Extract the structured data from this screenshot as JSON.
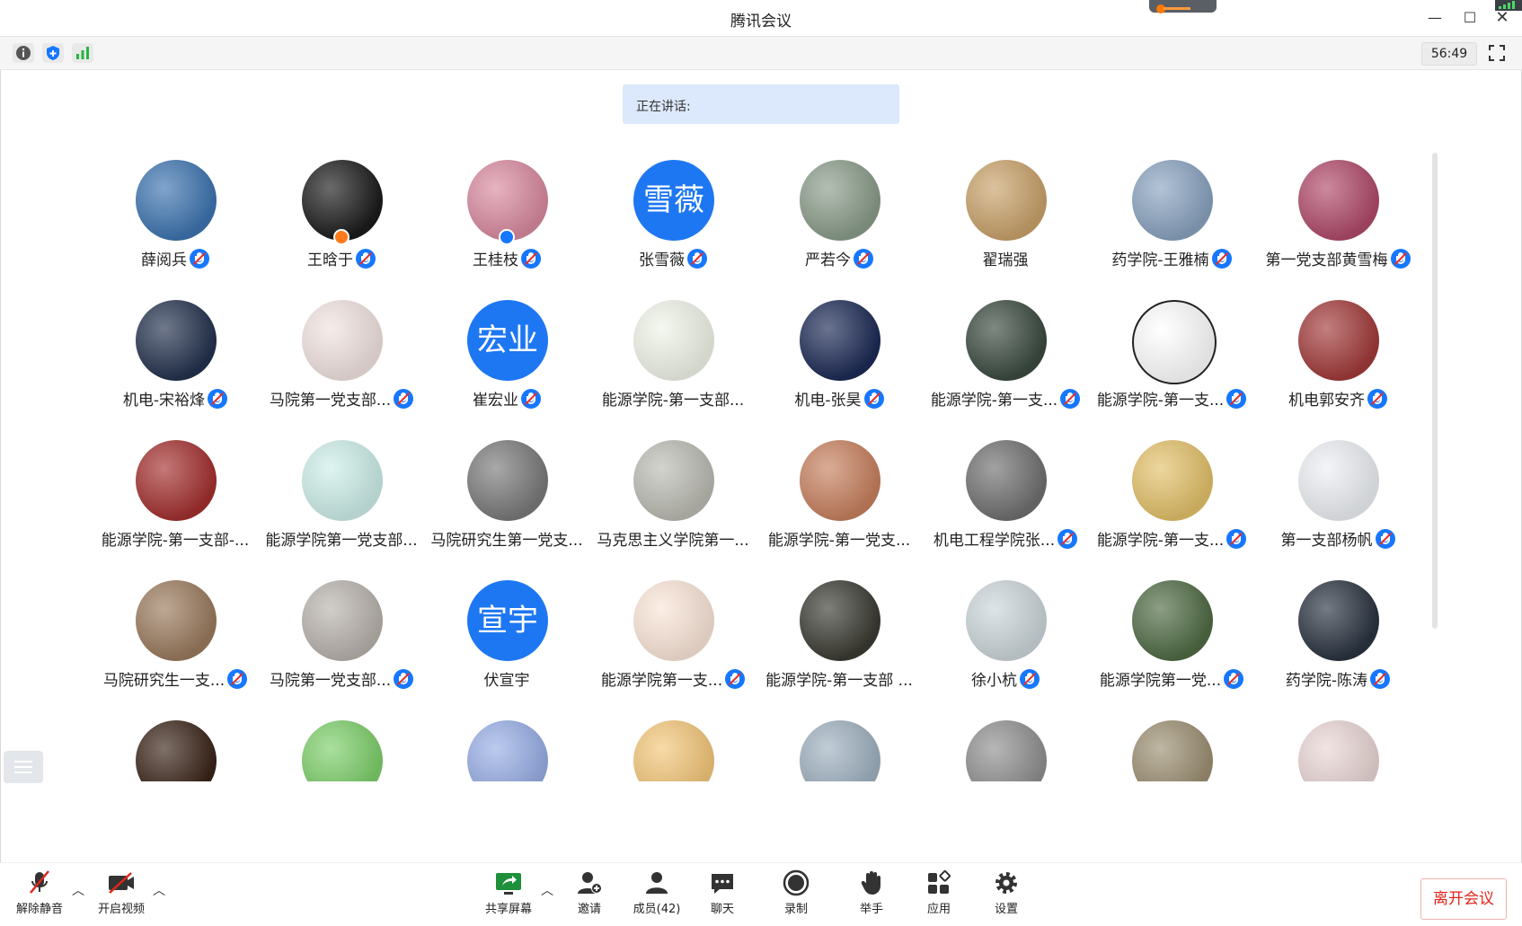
{
  "window": {
    "title": "腾讯会议"
  },
  "toolbar": {
    "timer": "56:49"
  },
  "speaking": {
    "label": "正在讲话:"
  },
  "participants": [
    {
      "name": "薛阅兵",
      "mic": true
    },
    {
      "name": "王晗于",
      "mic": true
    },
    {
      "name": "王桂枝",
      "mic": true
    },
    {
      "name": "张雪薇",
      "mic": true,
      "avatar_text": "雪薇"
    },
    {
      "name": "严若今",
      "mic": true
    },
    {
      "name": "翟瑞强",
      "mic": false
    },
    {
      "name": "药学院-王雅楠",
      "mic": true
    },
    {
      "name": "第一党支部黄雪梅",
      "mic": true
    },
    {
      "name": "机电-宋裕烽",
      "mic": true
    },
    {
      "name": "马院第一党支部...",
      "mic": true
    },
    {
      "name": "崔宏业",
      "mic": true,
      "avatar_text": "宏业"
    },
    {
      "name": "能源学院-第一支部...",
      "mic": false
    },
    {
      "name": "机电-张昊",
      "mic": true
    },
    {
      "name": "能源学院-第一支...",
      "mic": true
    },
    {
      "name": "能源学院-第一支...",
      "mic": true
    },
    {
      "name": "机电郭安齐",
      "mic": true
    },
    {
      "name": "能源学院-第一支部-...",
      "mic": false
    },
    {
      "name": "能源学院第一党支部...",
      "mic": false
    },
    {
      "name": "马院研究生第一党支...",
      "mic": false
    },
    {
      "name": "马克思主义学院第一...",
      "mic": false
    },
    {
      "name": "能源学院-第一党支...",
      "mic": false
    },
    {
      "name": "机电工程学院张...",
      "mic": true
    },
    {
      "name": "能源学院-第一支...",
      "mic": true
    },
    {
      "name": "第一支部杨帆",
      "mic": true
    },
    {
      "name": "马院研究生一支...",
      "mic": true
    },
    {
      "name": "马院第一党支部...",
      "mic": true
    },
    {
      "name": "伏宣宇",
      "mic": false,
      "avatar_text": "宣宇"
    },
    {
      "name": "能源学院第一支...",
      "mic": true
    },
    {
      "name": "能源学院-第一支部 ...",
      "mic": false
    },
    {
      "name": "徐小杭",
      "mic": true
    },
    {
      "name": "能源学院第一党...",
      "mic": true
    },
    {
      "name": "药学院-陈涛",
      "mic": true
    },
    {
      "name": "",
      "mic": false
    },
    {
      "name": "",
      "mic": false
    },
    {
      "name": "",
      "mic": false
    },
    {
      "name": "",
      "mic": false
    },
    {
      "name": "",
      "mic": false
    },
    {
      "name": "",
      "mic": false
    },
    {
      "name": "",
      "mic": false
    },
    {
      "name": "",
      "mic": false
    }
  ],
  "bottom": {
    "unmute": "解除静音",
    "start_video": "开启视频",
    "share": "共享屏幕",
    "invite": "邀请",
    "members": "成员(42)",
    "chat": "聊天",
    "record": "录制",
    "raise_hand": "举手",
    "apps": "应用",
    "settings": "设置",
    "leave": "离开会议"
  },
  "colors": {
    "accent": "#1677ff",
    "leave_red": "#e1251b",
    "speaking_bg": "#dce8fb"
  }
}
